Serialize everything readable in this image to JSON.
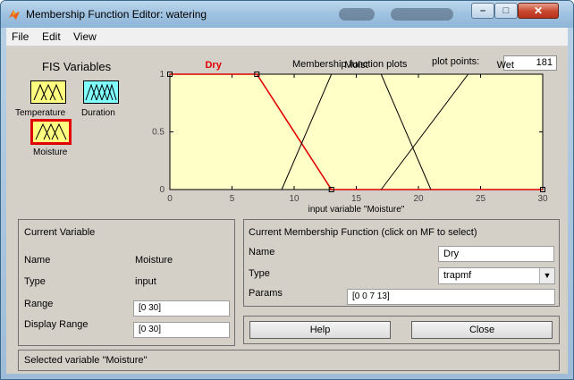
{
  "window": {
    "title": "Membership Function Editor: watering",
    "controls": {
      "minimize": "–",
      "maximize": "□",
      "close": "✕"
    }
  },
  "menu": [
    "File",
    "Edit",
    "View"
  ],
  "fis_variables": {
    "title": "FIS Variables",
    "variables": [
      {
        "name": "Temperature",
        "color": "#ffff80",
        "selected": false
      },
      {
        "name": "Duration",
        "color": "#80ffff",
        "selected": false
      },
      {
        "name": "Moisture",
        "color": "#ffff80",
        "selected": true
      }
    ]
  },
  "plot_header": {
    "title": "Membership function plots",
    "plot_points_label": "plot points:",
    "plot_points_value": "181"
  },
  "chart_data": {
    "type": "line",
    "xlabel": "input variable \"Moisture\"",
    "xlim": [
      0,
      30
    ],
    "ylim": [
      0,
      1
    ],
    "xticks": [
      0,
      5,
      10,
      15,
      20,
      25,
      30
    ],
    "yticks": [
      0,
      0.5,
      1
    ],
    "background": "#ffffc8",
    "series": [
      {
        "name": "Dry",
        "color": "#e00000",
        "selected": true,
        "x": [
          0,
          0,
          7,
          13,
          30
        ],
        "y": [
          1,
          1,
          1,
          0,
          0
        ]
      },
      {
        "name": "Moist",
        "color": "#000000",
        "selected": false,
        "x": [
          9,
          13,
          17,
          21
        ],
        "y": [
          0,
          1,
          1,
          0
        ]
      },
      {
        "name": "Wet",
        "color": "#000000",
        "selected": false,
        "x": [
          17,
          24,
          30
        ],
        "y": [
          0,
          1,
          1
        ]
      }
    ]
  },
  "current_variable": {
    "title": "Current Variable",
    "name_label": "Name",
    "name_value": "Moisture",
    "type_label": "Type",
    "type_value": "input",
    "range_label": "Range",
    "range_value": "[0 30]",
    "display_range_label": "Display Range",
    "display_range_value": "[0 30]"
  },
  "current_mf": {
    "title": "Current Membership Function (click on MF to select)",
    "name_label": "Name",
    "name_value": "Dry",
    "type_label": "Type",
    "type_value": "trapmf",
    "params_label": "Params",
    "params_value": "[0 0 7 13]"
  },
  "buttons": {
    "help": "Help",
    "close": "Close"
  },
  "status": {
    "text": "Selected variable \"Moisture\""
  }
}
